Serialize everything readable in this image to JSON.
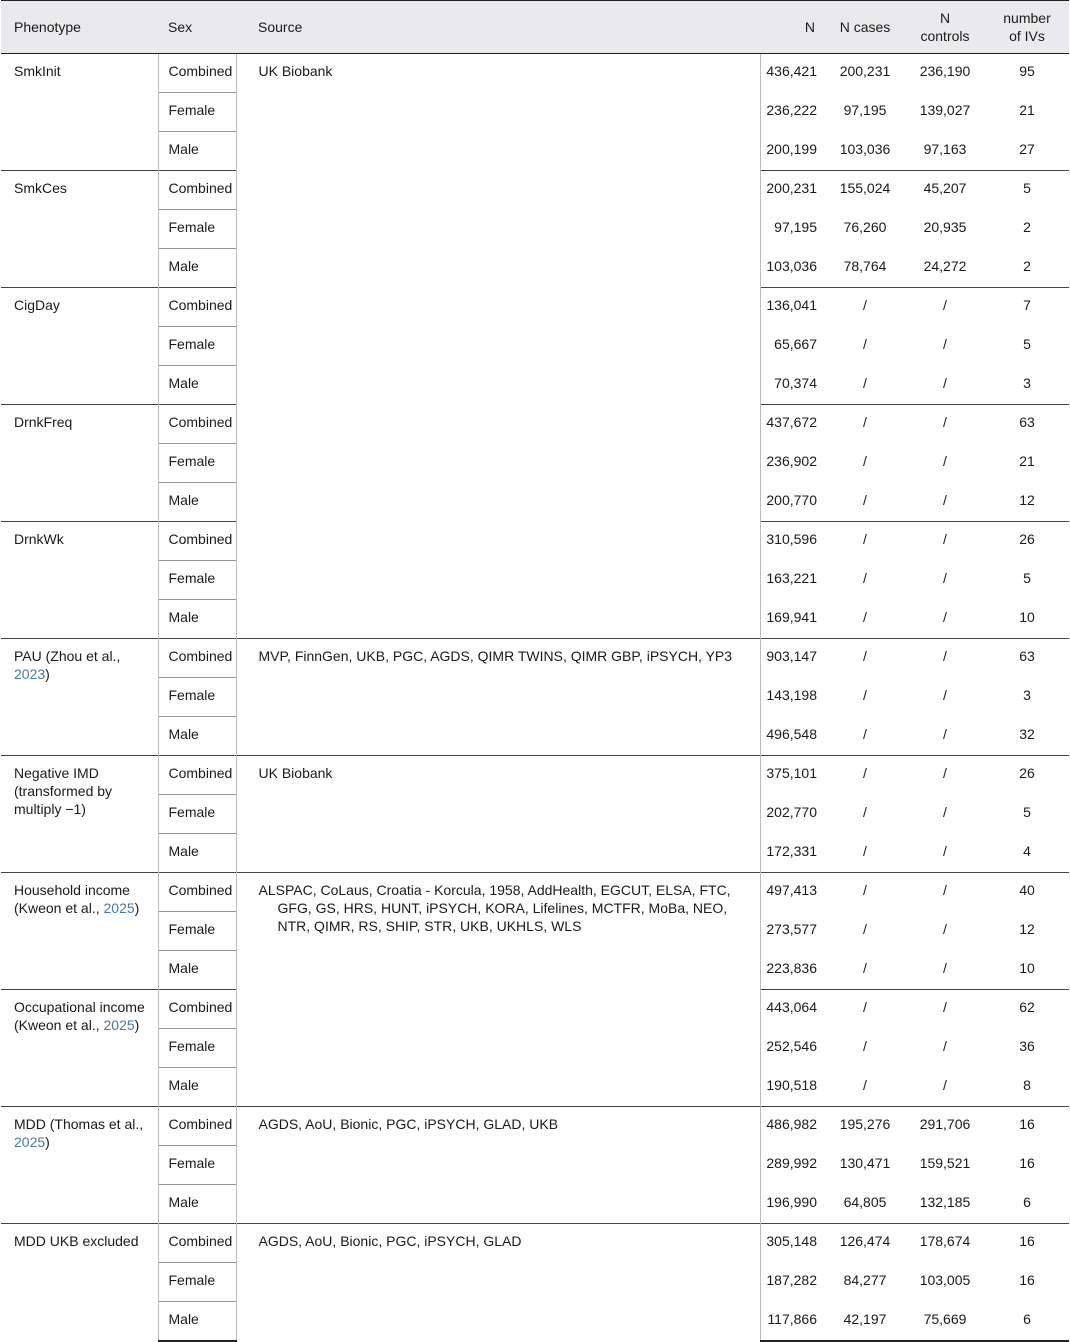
{
  "headers": {
    "phenotype": "Phenotype",
    "sex": "Sex",
    "source": "Source",
    "n": "N",
    "n_cases": "N cases",
    "n_controls_1": "N",
    "n_controls_2": "controls",
    "ivs_1": "number",
    "ivs_2": "of IVs"
  },
  "groups": [
    {
      "phenotype": "SmkInit",
      "source": "UK Biobank",
      "rows": [
        {
          "sex": "Combined",
          "n": "436,421",
          "cases": "200,231",
          "controls": "236,190",
          "ivs": "95"
        },
        {
          "sex": "Female",
          "n": "236,222",
          "cases": "97,195",
          "controls": "139,027",
          "ivs": "21"
        },
        {
          "sex": "Male",
          "n": "200,199",
          "cases": "103,036",
          "controls": "97,163",
          "ivs": "27"
        }
      ]
    },
    {
      "phenotype": "SmkCes",
      "source": "",
      "rows": [
        {
          "sex": "Combined",
          "n": "200,231",
          "cases": "155,024",
          "controls": "45,207",
          "ivs": "5"
        },
        {
          "sex": "Female",
          "n": "97,195",
          "cases": "76,260",
          "controls": "20,935",
          "ivs": "2"
        },
        {
          "sex": "Male",
          "n": "103,036",
          "cases": "78,764",
          "controls": "24,272",
          "ivs": "2"
        }
      ]
    },
    {
      "phenotype": "CigDay",
      "source": "",
      "rows": [
        {
          "sex": "Combined",
          "n": "136,041",
          "cases": "/",
          "controls": "/",
          "ivs": "7"
        },
        {
          "sex": "Female",
          "n": "65,667",
          "cases": "/",
          "controls": "/",
          "ivs": "5"
        },
        {
          "sex": "Male",
          "n": "70,374",
          "cases": "/",
          "controls": "/",
          "ivs": "3"
        }
      ]
    },
    {
      "phenotype": "DrnkFreq",
      "source": "",
      "rows": [
        {
          "sex": "Combined",
          "n": "437,672",
          "cases": "/",
          "controls": "/",
          "ivs": "63"
        },
        {
          "sex": "Female",
          "n": "236,902",
          "cases": "/",
          "controls": "/",
          "ivs": "21"
        },
        {
          "sex": "Male",
          "n": "200,770",
          "cases": "/",
          "controls": "/",
          "ivs": "12"
        }
      ]
    },
    {
      "phenotype": "DrnkWk",
      "source": "",
      "rows": [
        {
          "sex": "Combined",
          "n": "310,596",
          "cases": "/",
          "controls": "/",
          "ivs": "26"
        },
        {
          "sex": "Female",
          "n": "163,221",
          "cases": "/",
          "controls": "/",
          "ivs": "5"
        },
        {
          "sex": "Male",
          "n": "169,941",
          "cases": "/",
          "controls": "/",
          "ivs": "10"
        }
      ]
    },
    {
      "phenotype": "PAU (Zhou et al., ",
      "phenotype_ref": "2023",
      "phenotype_tail": ")",
      "source": "MVP, FinnGen, UKB, PGC, AGDS, QIMR TWINS, QIMR GBP, iPSYCH, YP3",
      "rows": [
        {
          "sex": "Combined",
          "n": "903,147",
          "cases": "/",
          "controls": "/",
          "ivs": "63"
        },
        {
          "sex": "Female",
          "n": "143,198",
          "cases": "/",
          "controls": "/",
          "ivs": "3"
        },
        {
          "sex": "Male",
          "n": "496,548",
          "cases": "/",
          "controls": "/",
          "ivs": "32"
        }
      ]
    },
    {
      "phenotype": "Negative IMD (transformed by multiply −1)",
      "source": "UK Biobank",
      "rows": [
        {
          "sex": "Combined",
          "n": "375,101",
          "cases": "/",
          "controls": "/",
          "ivs": "26"
        },
        {
          "sex": "Female",
          "n": "202,770",
          "cases": "/",
          "controls": "/",
          "ivs": "5"
        },
        {
          "sex": "Male",
          "n": "172,331",
          "cases": "/",
          "controls": "/",
          "ivs": "4"
        }
      ]
    },
    {
      "phenotype": "Household income (Kweon et al., ",
      "phenotype_ref": "2025",
      "phenotype_tail": ")",
      "source": "ALSPAC, CoLaus, Croatia - Korcula, 1958, AddHealth, EGCUT, ELSA, FTC, GFG, GS, HRS, HUNT, iPSYCH, KORA, Lifelines, MCTFR, MoBa, NEO, NTR, QIMR, RS, SHIP, STR, UKB, UKHLS, WLS",
      "rows": [
        {
          "sex": "Combined",
          "n": "497,413",
          "cases": "/",
          "controls": "/",
          "ivs": "40"
        },
        {
          "sex": "Female",
          "n": "273,577",
          "cases": "/",
          "controls": "/",
          "ivs": "12"
        },
        {
          "sex": "Male",
          "n": "223,836",
          "cases": "/",
          "controls": "/",
          "ivs": "10"
        }
      ]
    },
    {
      "phenotype": "Occupational income (Kweon et al., ",
      "phenotype_ref": "2025",
      "phenotype_tail": ")",
      "source": "",
      "rows": [
        {
          "sex": "Combined",
          "n": "443,064",
          "cases": "/",
          "controls": "/",
          "ivs": "62"
        },
        {
          "sex": "Female",
          "n": "252,546",
          "cases": "/",
          "controls": "/",
          "ivs": "36"
        },
        {
          "sex": "Male",
          "n": "190,518",
          "cases": "/",
          "controls": "/",
          "ivs": "8"
        }
      ]
    },
    {
      "phenotype": "MDD (Thomas et al., ",
      "phenotype_ref": "2025",
      "phenotype_tail": ")",
      "source": "AGDS, AoU, Bionic, PGC, iPSYCH, GLAD, UKB",
      "rows": [
        {
          "sex": "Combined",
          "n": "486,982",
          "cases": "195,276",
          "controls": "291,706",
          "ivs": "16"
        },
        {
          "sex": "Female",
          "n": "289,992",
          "cases": "130,471",
          "controls": "159,521",
          "ivs": "16"
        },
        {
          "sex": "Male",
          "n": "196,990",
          "cases": "64,805",
          "controls": "132,185",
          "ivs": "6"
        }
      ]
    },
    {
      "phenotype": "MDD UKB excluded",
      "source": "AGDS, AoU, Bionic, PGC, iPSYCH, GLAD",
      "rows": [
        {
          "sex": "Combined",
          "n": "305,148",
          "cases": "126,474",
          "controls": "178,674",
          "ivs": "16"
        },
        {
          "sex": "Female",
          "n": "187,282",
          "cases": "84,277",
          "controls": "103,005",
          "ivs": "16"
        },
        {
          "sex": "Male",
          "n": "117,866",
          "cases": "42,197",
          "controls": "75,669",
          "ivs": "6"
        }
      ]
    }
  ]
}
